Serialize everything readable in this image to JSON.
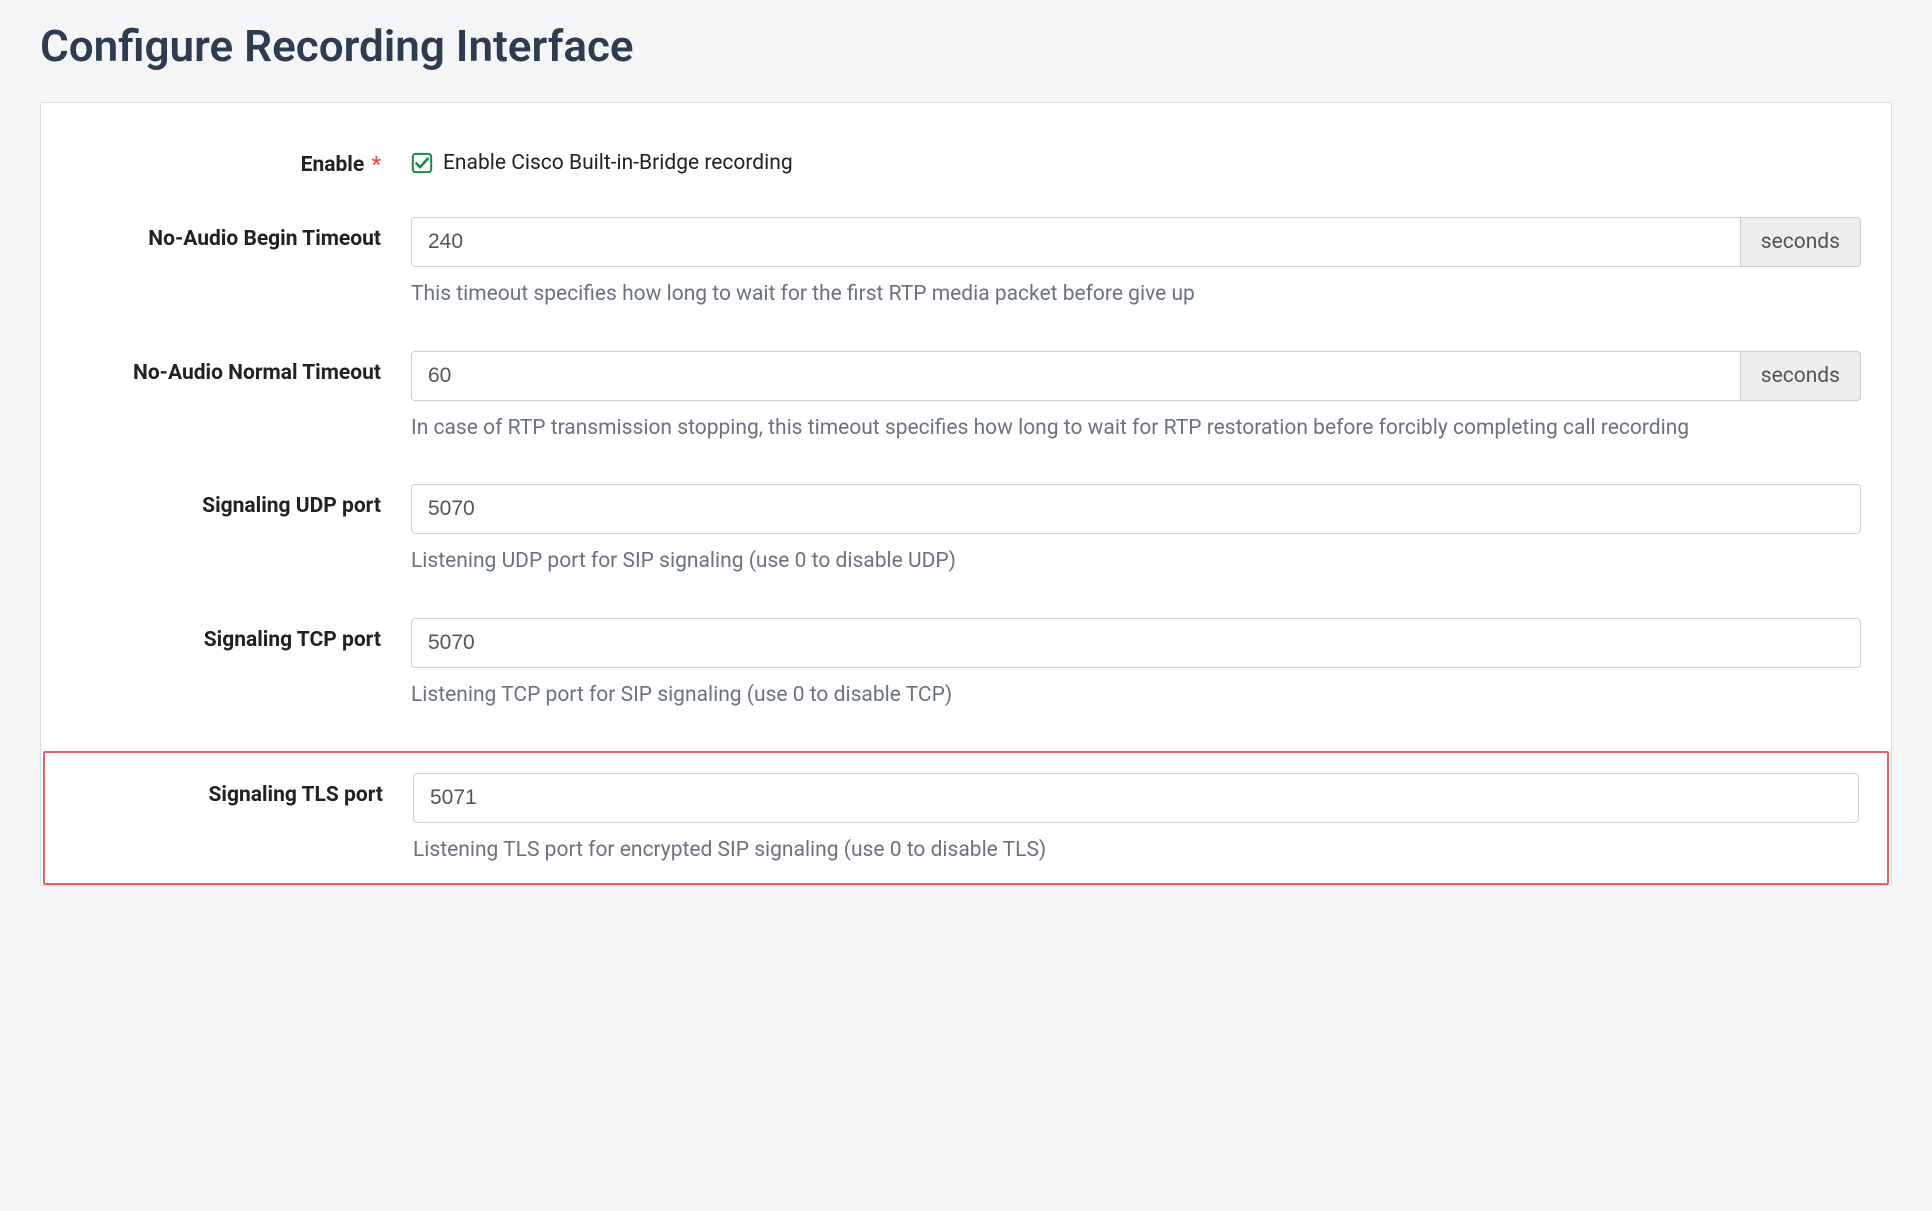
{
  "page": {
    "title": "Configure Recording Interface"
  },
  "fields": {
    "enable": {
      "label": "Enable",
      "required_marker": "*",
      "checkbox_label": "Enable Cisco Built-in-Bridge recording",
      "checked": true
    },
    "no_audio_begin": {
      "label": "No-Audio Begin Timeout",
      "value": "240",
      "unit": "seconds",
      "help": "This timeout specifies how long to wait for the first RTP media packet before give up"
    },
    "no_audio_normal": {
      "label": "No-Audio Normal Timeout",
      "value": "60",
      "unit": "seconds",
      "help": "In case of RTP transmission stopping, this timeout specifies how long to wait for RTP restoration before forcibly completing call recording"
    },
    "sig_udp": {
      "label": "Signaling UDP port",
      "value": "5070",
      "help": "Listening UDP port for SIP signaling (use 0 to disable UDP)"
    },
    "sig_tcp": {
      "label": "Signaling TCP port",
      "value": "5070",
      "help": "Listening TCP port for SIP signaling (use 0 to disable TCP)"
    },
    "sig_tls": {
      "label": "Signaling TLS port",
      "value": "5071",
      "help": "Listening TLS port for encrypted SIP signaling (use 0 to disable TLS)"
    }
  }
}
